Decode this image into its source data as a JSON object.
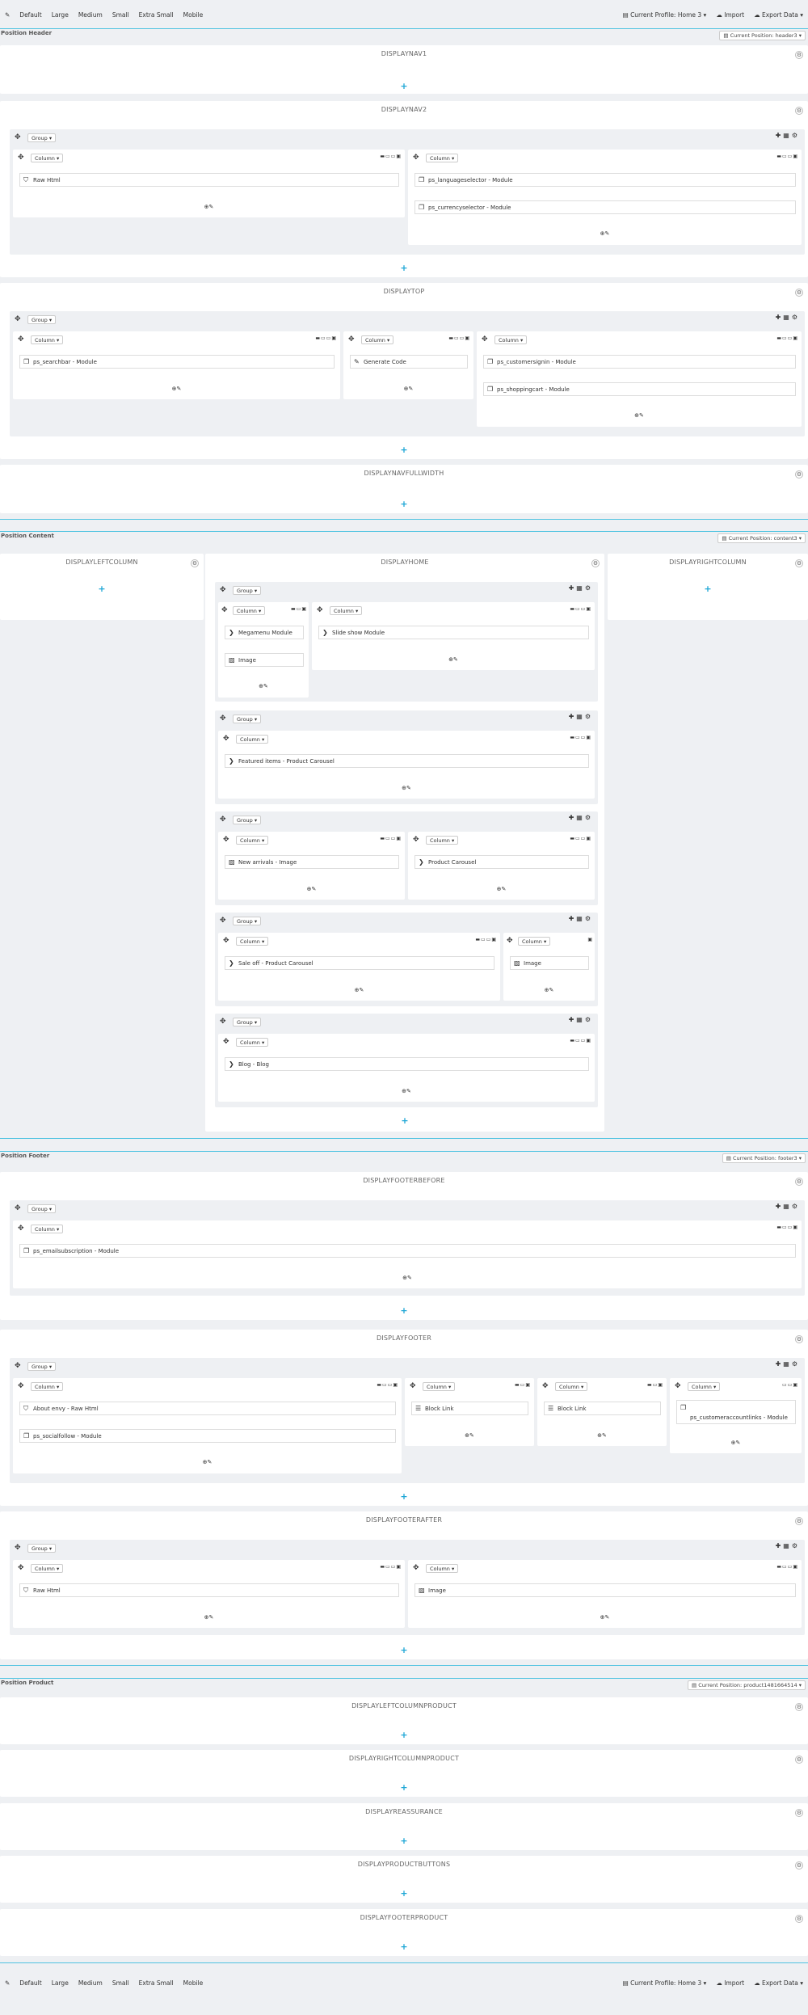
{
  "toolbar": {
    "devices": [
      "Default",
      "Large",
      "Medium",
      "Small",
      "Extra Small",
      "Mobile"
    ],
    "profile": "Current Profile: Home 3",
    "import": "Import",
    "export": "Export Data"
  },
  "positions": {
    "header": {
      "title": "Position Header",
      "current": "Current Position: header3"
    },
    "content": {
      "title": "Position Content",
      "current": "Current Position: content3"
    },
    "footer": {
      "title": "Position Footer",
      "current": "Current Position: footer3"
    },
    "product": {
      "title": "Position Product",
      "current": "Current Position: product1481664514"
    }
  },
  "hooks": {
    "displaynav1": "DISPLAYNAV1",
    "displaynav2": "DISPLAYNAV2",
    "displaytop": "DISPLAYTOP",
    "displaynavfullwidth": "DISPLAYNAVFULLWIDTH",
    "displayleftcolumn": "DISPLAYLEFTCOLUMN",
    "displayhome": "DISPLAYHOME",
    "displayrightcolumn": "DISPLAYRIGHTCOLUMN",
    "displayfooterbefore": "DISPLAYFOOTERBEFORE",
    "displayfooter": "DISPLAYFOOTER",
    "displayfooterafter": "DISPLAYFOOTERAFTER",
    "displayleftcolumnproduct": "DISPLAYLEFTCOLUMNPRODUCT",
    "displayrightcolumnproduct": "DISPLAYRIGHTCOLUMNPRODUCT",
    "displayreassurance": "DISPLAYREASSURANCE",
    "displayproductbuttons": "DISPLAYPRODUCTBUTTONS",
    "displayfooterproduct": "DISPLAYFOOTERPRODUCT"
  },
  "labels": {
    "group": "Group ▾",
    "column": "Column ▾"
  },
  "modules": {
    "raw_html": "Raw Html",
    "languageselector": "ps_languageselector - Module",
    "currencyselector": "ps_currencyselector - Module",
    "searchbar": "ps_searchbar - Module",
    "generate_code": "Generate Code",
    "customersignin": "ps_customersignin - Module",
    "shoppingcart": "ps_shoppingcart - Module",
    "megamenu": "Megamenu Module",
    "image": "Image",
    "slideshow": "Slide show Module",
    "featured": "Featured items - Product Carousel",
    "new_arrivals": "New arrivals - Image",
    "product_carousel": "Product Carousel",
    "sale_off": "Sale off - Product Carousel",
    "blog": "Blog - Blog",
    "emailsubscription": "ps_emailsubscription - Module",
    "about": "About envy - Raw Html",
    "block_link": "Block Link",
    "customeraccountlinks": "ps_customeraccountlinks - Module",
    "socialfollow": "ps_socialfollow - Module"
  }
}
